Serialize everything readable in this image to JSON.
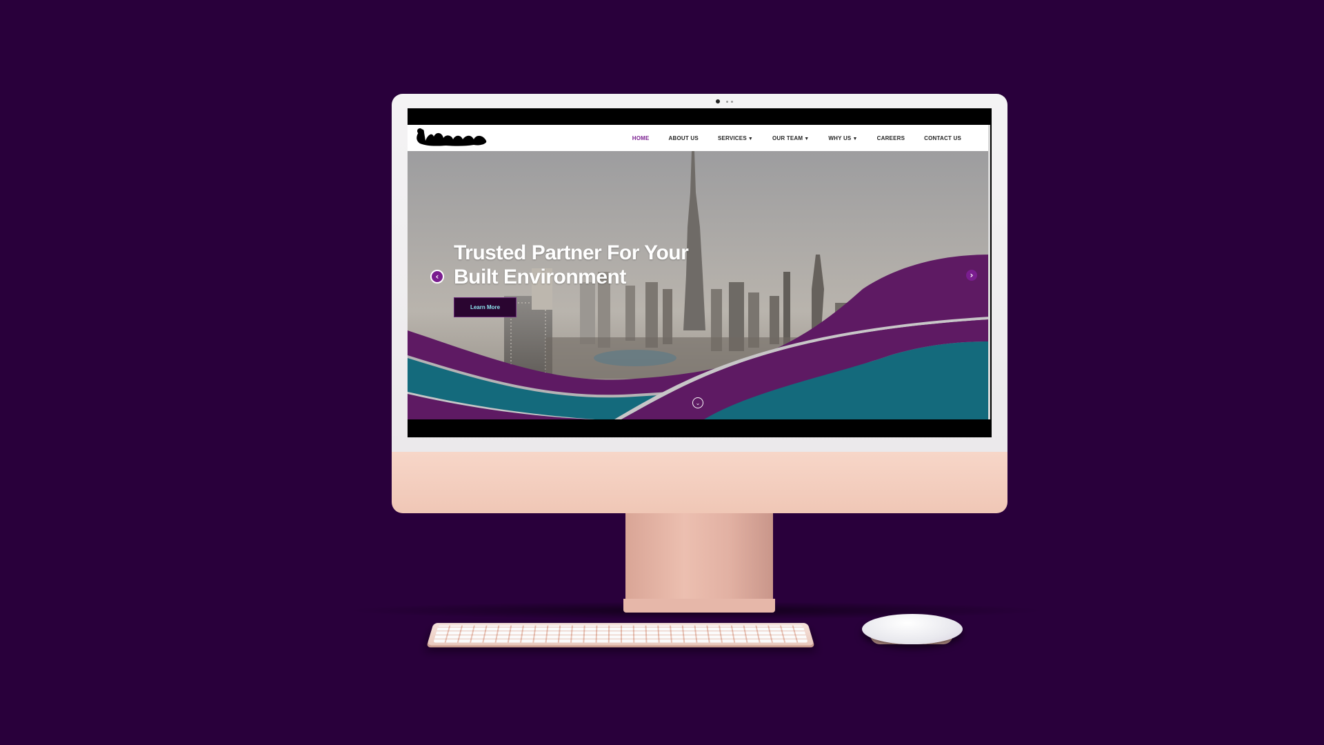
{
  "colors": {
    "background": "#29003b",
    "accent_purple": "#5e1a63",
    "accent_teal": "#146a7c",
    "active_nav": "#7a1d8f",
    "button_bg": "#2a0530",
    "button_text": "#8ee7f0"
  },
  "nav": {
    "items": [
      {
        "label": "HOME",
        "active": true,
        "has_dropdown": false
      },
      {
        "label": "ABOUT US",
        "active": false,
        "has_dropdown": false
      },
      {
        "label": "SERVICES",
        "active": false,
        "has_dropdown": true
      },
      {
        "label": "OUR TEAM",
        "active": false,
        "has_dropdown": true
      },
      {
        "label": "WHY US",
        "active": false,
        "has_dropdown": true
      },
      {
        "label": "CAREERS",
        "active": false,
        "has_dropdown": false
      },
      {
        "label": "CONTACT US",
        "active": false,
        "has_dropdown": false
      }
    ],
    "caret": "▼"
  },
  "hero": {
    "title_line1": "Trusted Partner For Your",
    "title_line2": "Built Environment",
    "button_label": "Learn More",
    "prev_icon": "‹",
    "next_icon": "›",
    "scroll_icon": "⌄"
  },
  "icons": {
    "logo": "logo-redacted",
    "prev": "chevron-left-icon",
    "next": "chevron-right-icon",
    "scroll": "chevron-down-circle-icon"
  }
}
